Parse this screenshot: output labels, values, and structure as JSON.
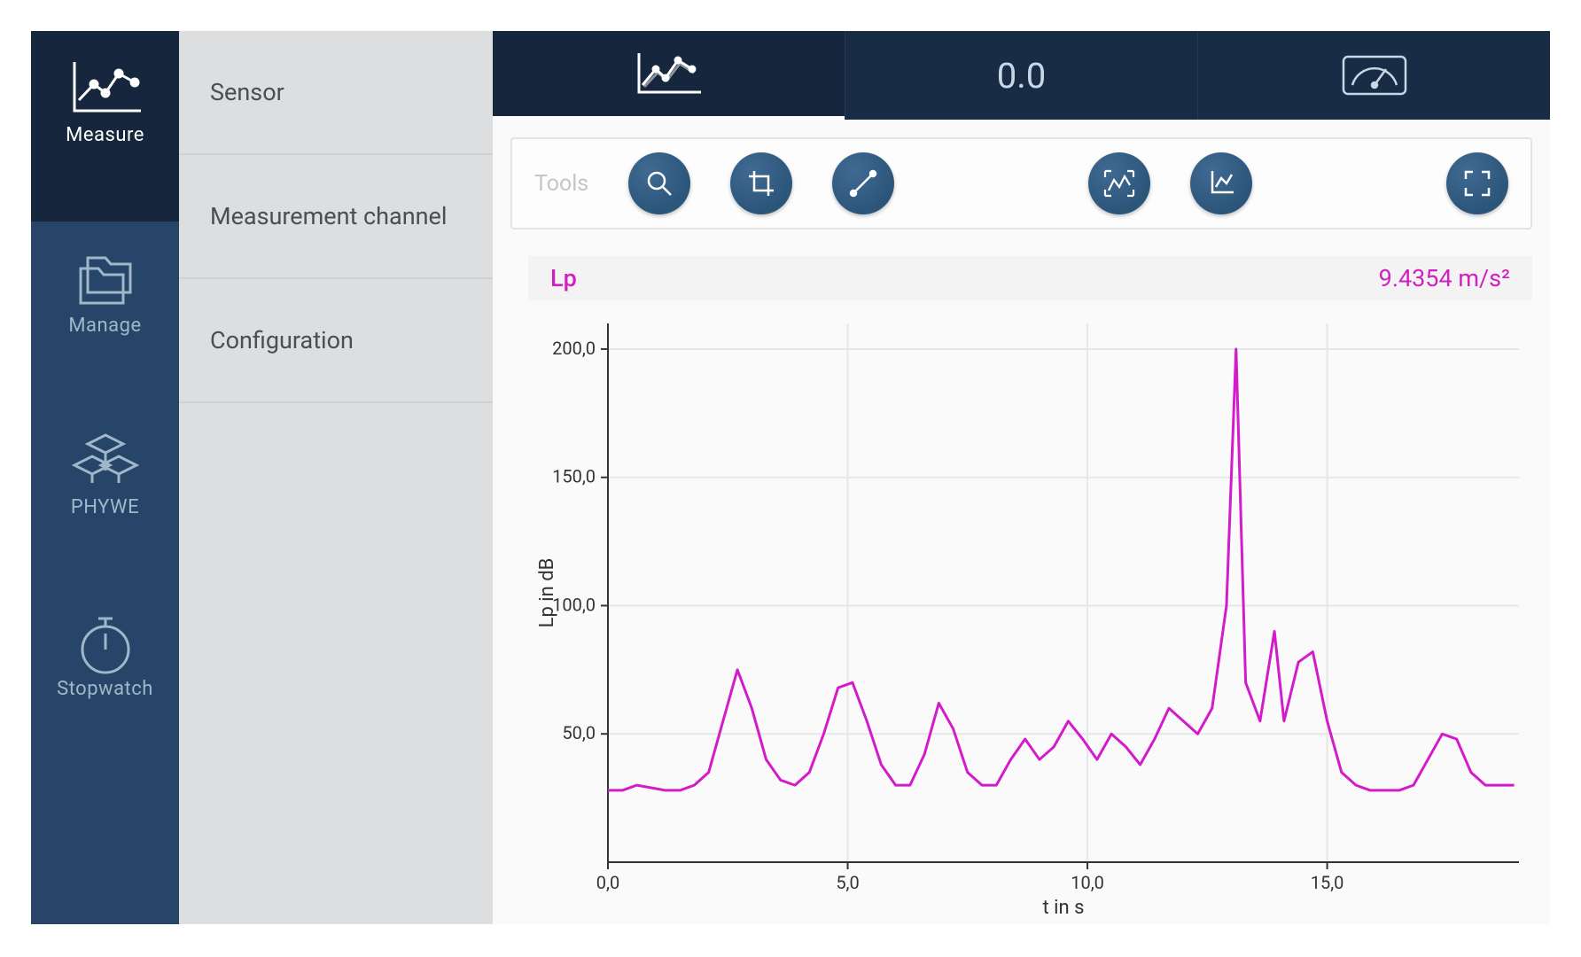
{
  "colors": {
    "rail": "#274569",
    "rail_active": "#16263d",
    "rail_text": "#9fb7c9",
    "sub_bg": "#dcdee0",
    "sub_text": "#4a4f55",
    "accent_series": "#d41bcb",
    "tool_btn": "#34628b"
  },
  "nav": {
    "items": [
      {
        "icon": "line-chart-icon",
        "label": "Measure",
        "active": true
      },
      {
        "icon": "folders-icon",
        "label": "Manage",
        "active": false
      },
      {
        "icon": "cubes-icon",
        "label": "PHYWE",
        "active": false
      },
      {
        "icon": "stopwatch-icon",
        "label": "Stopwatch",
        "active": false
      }
    ]
  },
  "submenu": {
    "items": [
      {
        "label": "Sensor"
      },
      {
        "label": "Measurement channel"
      },
      {
        "label": "Configuration"
      }
    ]
  },
  "top_tabs": {
    "items": [
      {
        "kind": "icon",
        "icon": "line-chart-icon",
        "active": true
      },
      {
        "kind": "text",
        "label": "0.0",
        "active": false
      },
      {
        "kind": "icon",
        "icon": "gauge-icon",
        "active": false
      }
    ]
  },
  "tools": {
    "label": "Tools",
    "buttons": [
      {
        "icon": "zoom-icon",
        "name": "tool-zoom"
      },
      {
        "icon": "crop-icon",
        "name": "tool-crop"
      },
      {
        "icon": "line-segment-icon",
        "name": "tool-line"
      },
      {
        "gap": true
      },
      {
        "icon": "fit-graph-icon",
        "name": "tool-fit"
      },
      {
        "icon": "axes-icon",
        "name": "tool-axes"
      },
      {
        "gap": true
      },
      {
        "icon": "fullscreen-icon",
        "name": "tool-fullscreen"
      }
    ]
  },
  "chart_header": {
    "series_label": "Lp",
    "current_value": "9.4354 m/s²"
  },
  "chart_data": {
    "type": "line",
    "title": "",
    "xlabel": "t in s",
    "ylabel": "Lp in dB",
    "xlim": [
      0,
      19
    ],
    "ylim": [
      0,
      210
    ],
    "xticks": [
      0.0,
      5.0,
      10.0,
      15.0
    ],
    "yticks": [
      50.0,
      100.0,
      150.0,
      200.0
    ],
    "xtick_labels": [
      "0,0",
      "5,0",
      "10,0",
      "15,0"
    ],
    "ytick_labels": [
      "50,0",
      "100,0",
      "150,0",
      "200,0"
    ],
    "series": [
      {
        "name": "Lp",
        "color": "#d41bcb",
        "x": [
          0.0,
          0.3,
          0.6,
          0.9,
          1.2,
          1.5,
          1.8,
          2.1,
          2.4,
          2.7,
          3.0,
          3.3,
          3.6,
          3.9,
          4.2,
          4.5,
          4.8,
          5.1,
          5.4,
          5.7,
          6.0,
          6.3,
          6.6,
          6.9,
          7.2,
          7.5,
          7.8,
          8.1,
          8.4,
          8.7,
          9.0,
          9.3,
          9.6,
          9.9,
          10.2,
          10.5,
          10.8,
          11.1,
          11.4,
          11.7,
          12.0,
          12.3,
          12.6,
          12.9,
          13.1,
          13.3,
          13.6,
          13.9,
          14.1,
          14.4,
          14.7,
          15.0,
          15.3,
          15.6,
          15.9,
          16.2,
          16.5,
          16.8,
          17.1,
          17.4,
          17.7,
          18.0,
          18.3,
          18.6,
          18.9
        ],
        "y": [
          28,
          28,
          30,
          29,
          28,
          28,
          30,
          35,
          55,
          75,
          60,
          40,
          32,
          30,
          35,
          50,
          68,
          70,
          55,
          38,
          30,
          30,
          42,
          62,
          52,
          35,
          30,
          30,
          40,
          48,
          40,
          45,
          55,
          48,
          40,
          50,
          45,
          38,
          48,
          60,
          55,
          50,
          60,
          100,
          200,
          70,
          55,
          90,
          55,
          78,
          82,
          55,
          35,
          30,
          28,
          28,
          28,
          30,
          40,
          50,
          48,
          35,
          30,
          30,
          30
        ]
      }
    ]
  }
}
